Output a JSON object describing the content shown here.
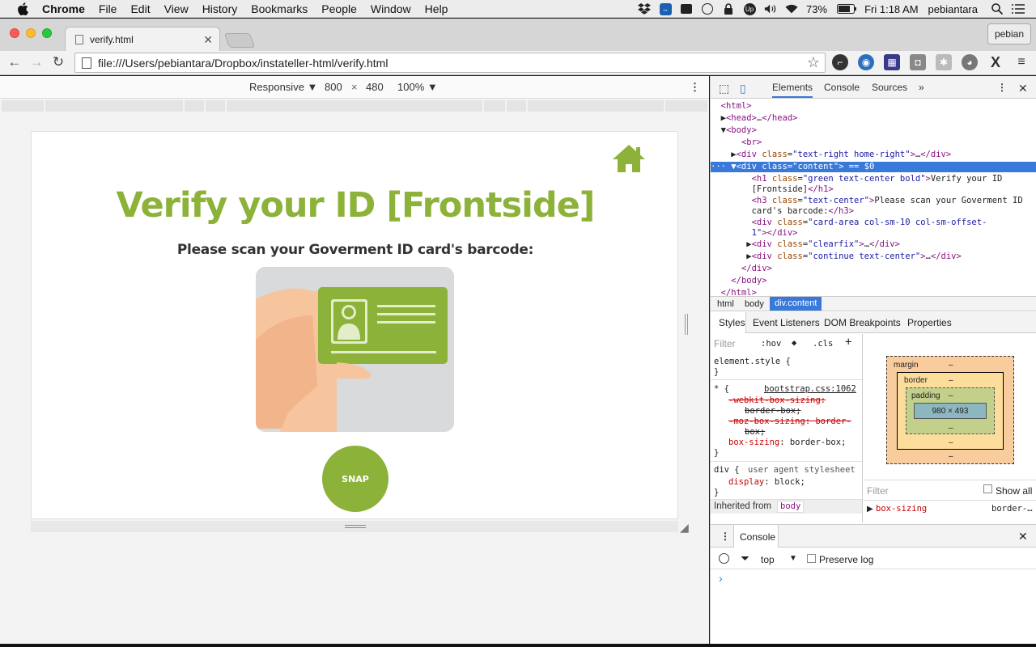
{
  "menubar": {
    "app": "Chrome",
    "items": [
      "File",
      "Edit",
      "View",
      "History",
      "Bookmarks",
      "People",
      "Window",
      "Help"
    ],
    "battery": "73%",
    "clock": "Fri 1:18 AM",
    "user": "pebiantara"
  },
  "browser": {
    "tab_title": "verify.html",
    "profile": "pebian",
    "url": "file:///Users/pebiantara/Dropbox/instateller-html/verify.html"
  },
  "device_toolbar": {
    "mode": "Responsive",
    "width": "800",
    "times": "×",
    "height": "480",
    "zoom": "100%"
  },
  "page": {
    "title": "Verify your ID [Frontside]",
    "subtitle": "Please scan your Goverment ID card's barcode:",
    "snap_label": "SNAP",
    "brand_color": "#8db23a"
  },
  "devtools": {
    "tabs": [
      "Elements",
      "Console",
      "Sources"
    ],
    "more": "»",
    "breadcrumbs": [
      "html",
      "body",
      "div.content"
    ],
    "subtabs": [
      "Styles",
      "Event Listeners",
      "DOM Breakpoints",
      "Properties"
    ],
    "filter_placeholder": "Filter",
    "hov": ":hov",
    "cls": ".cls",
    "element_style": "element.style {",
    "bootstrap_link": "bootstrap.css:1062",
    "ua_label": "user agent stylesheet",
    "inherited_from": "Inherited from",
    "inherited_tag": "body",
    "box_margin": "margin",
    "box_border": "border",
    "box_padding": "padding",
    "box_content": "980 × 493",
    "dash": "–",
    "show_all": "Show all",
    "computed_prop": "box-sizing",
    "computed_val": "border-…",
    "console_tab": "Console",
    "console_context": "top",
    "preserve_log": "Preserve log",
    "prompt": "›"
  }
}
